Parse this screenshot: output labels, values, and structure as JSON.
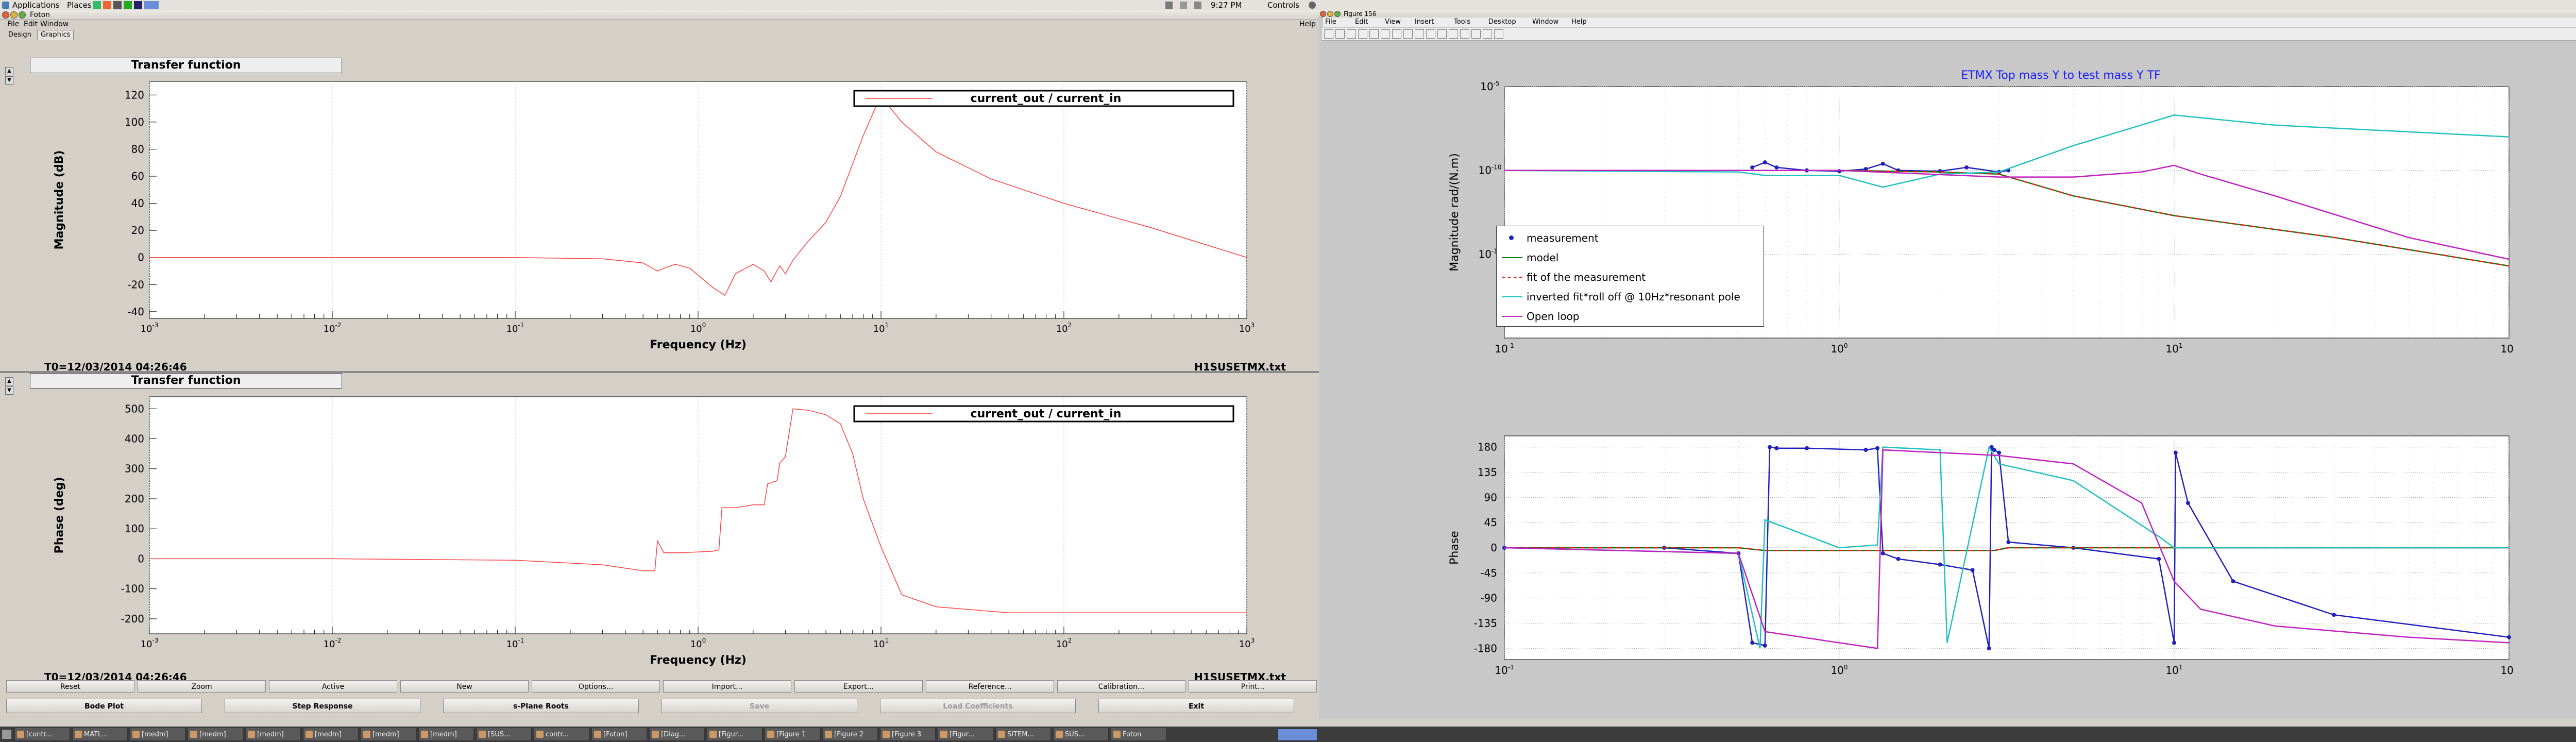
{
  "top_panel": {
    "menus": [
      "Applications",
      "Places"
    ],
    "clock": "9:27 PM",
    "user": "Controls",
    "status_icons": [
      "speaker-icon",
      "mail-icon",
      "network-icon"
    ]
  },
  "foton": {
    "window_title": "Foton",
    "menubar": [
      "File",
      "Edit",
      "Window"
    ],
    "help": "Help",
    "tabs": [
      "Design",
      "Graphics"
    ],
    "plots": [
      {
        "box_title": "Transfer function",
        "legend": "current_out / current_in",
        "ylabel": "Magnitude (dB)",
        "xlabel": "Frequency (Hz)",
        "footer_left": "T0=12/03/2014 04:26:46",
        "footer_right": "H1SUSETMX.txt",
        "yticks": [
          "120",
          "100",
          "80",
          "60",
          "40",
          "20",
          "0",
          "-20",
          "-40"
        ],
        "xticks": [
          "-3",
          "-2",
          "-1",
          "0",
          "1",
          "2",
          "3"
        ]
      },
      {
        "box_title": "Transfer function",
        "legend": "current_out / current_in",
        "ylabel": "Phase (deg)",
        "xlabel": "Frequency (Hz)",
        "footer_left": "T0=12/03/2014 04:26:46",
        "footer_right": "H1SUSETMX.txt",
        "yticks": [
          "500",
          "400",
          "300",
          "200",
          "100",
          "0",
          "-100",
          "-200"
        ],
        "xticks": [
          "-3",
          "-2",
          "-1",
          "0",
          "1",
          "2",
          "3"
        ]
      }
    ],
    "button_row1": [
      "Reset",
      "Zoom",
      "Active",
      "New",
      "Options...",
      "Import...",
      "Export...",
      "Reference...",
      "Calibration...",
      "Print..."
    ],
    "button_row2": [
      "Bode Plot",
      "Step Response",
      "s-Plane Roots",
      "Save",
      "Load Coefficients",
      "Exit"
    ],
    "disabled_buttons": [
      "Save",
      "Load Coefficients"
    ]
  },
  "figure": {
    "window_title": "Figure 156",
    "menubar": [
      "File",
      "Edit",
      "View",
      "Insert",
      "Tools",
      "Desktop",
      "Window",
      "Help"
    ],
    "title": "ETMX Top mass Y to test mass Y TF",
    "mag_ylabel": "Magnitude rad/(N.m)",
    "phase_ylabel": "Phase",
    "legend": [
      "measurement",
      "model",
      "fit of the measurement",
      "inverted fit*roll off @ 10Hz*resonant pole",
      "Open loop"
    ],
    "mag_yticks": [
      "-15",
      "-10",
      "-5"
    ],
    "x_ticks": [
      "-1",
      "0",
      "1",
      "2"
    ],
    "phase_yticks": [
      "180",
      "135",
      "90",
      "45",
      "0",
      "-45",
      "-90",
      "-135",
      "-180"
    ]
  },
  "taskbar": [
    "[contr...",
    "MATL...",
    "[medm]",
    "[medm]",
    "[medm]",
    "[medm]",
    "[medm]",
    "[medm]",
    "[SUS...",
    "contr...",
    "[Foton]",
    "[Diag...",
    "[Figur...",
    "[Figure 1",
    "[Figure 2",
    "[Figure 3",
    "[Figur...",
    "SITEM...",
    "SUS...",
    "Foton"
  ],
  "chart_data": [
    {
      "type": "line",
      "title": "Transfer function",
      "xlabel": "Frequency (Hz)",
      "ylabel": "Magnitude (dB)",
      "xscale": "log",
      "xlim": [
        0.001,
        1000
      ],
      "ylim": [
        -45,
        130
      ],
      "series": [
        {
          "name": "current_out / current_in",
          "color": "#ff4040",
          "x": [
            0.001,
            0.01,
            0.1,
            0.3,
            0.5,
            0.6,
            0.65,
            0.75,
            0.9,
            1.2,
            1.4,
            1.6,
            2.0,
            2.3,
            2.5,
            2.8,
            3.0,
            3.3,
            4,
            5,
            6,
            8,
            10,
            11,
            13,
            20,
            40,
            100,
            300,
            1000
          ],
          "y": [
            0,
            0,
            0,
            -1,
            -4,
            -10,
            -8,
            -5,
            -8,
            -22,
            -28,
            -12,
            -5,
            -10,
            -18,
            -6,
            -12,
            -2,
            12,
            26,
            45,
            90,
            120,
            112,
            100,
            78,
            58,
            40,
            22,
            0
          ]
        }
      ]
    },
    {
      "type": "line",
      "title": "Transfer function",
      "xlabel": "Frequency (Hz)",
      "ylabel": "Phase (deg)",
      "xscale": "log",
      "xlim": [
        0.001,
        1000
      ],
      "ylim": [
        -250,
        540
      ],
      "series": [
        {
          "name": "current_out / current_in",
          "color": "#ff4040",
          "x": [
            0.001,
            0.01,
            0.1,
            0.3,
            0.5,
            0.58,
            0.6,
            0.65,
            0.8,
            1.2,
            1.3,
            1.35,
            1.6,
            2.0,
            2.3,
            2.4,
            2.7,
            2.8,
            3.0,
            3.3,
            4,
            5,
            6,
            7,
            8,
            10,
            13,
            20,
            50,
            100,
            1000
          ],
          "y": [
            0,
            0,
            -5,
            -20,
            -40,
            -40,
            60,
            20,
            20,
            25,
            30,
            170,
            170,
            180,
            180,
            250,
            260,
            320,
            340,
            500,
            495,
            480,
            450,
            350,
            200,
            40,
            -120,
            -160,
            -180,
            -180,
            -180
          ]
        }
      ]
    },
    {
      "type": "line",
      "title": "ETMX Top mass Y to test mass Y TF",
      "ylabel": "Magnitude rad/(N.m)",
      "xscale": "log",
      "yscale": "log",
      "xlim": [
        0.1,
        100
      ],
      "ylim": [
        1e-20,
        1e-05
      ],
      "series": [
        {
          "name": "measurement",
          "color": "#2020c0",
          "x": [
            0.55,
            0.6,
            0.65,
            0.8,
            1.0,
            1.2,
            1.35,
            1.5,
            2.0,
            2.4,
            3.0,
            3.2
          ],
          "y": [
            1.5e-10,
            3e-10,
            1.5e-10,
            1e-10,
            9e-11,
            1.2e-10,
            2.5e-10,
            1e-10,
            9e-11,
            1.5e-10,
            8e-11,
            1e-10
          ]
        },
        {
          "name": "model",
          "color": "#008000",
          "x": [
            0.1,
            0.5,
            1,
            2,
            3,
            5,
            10,
            30,
            100
          ],
          "y": [
            1e-10,
            1e-10,
            1e-10,
            8e-11,
            6e-11,
            3e-12,
            2e-13,
            1e-14,
            2e-16
          ]
        },
        {
          "name": "fit of the measurement",
          "color": "#e02020",
          "x": [
            0.1,
            0.5,
            1,
            2,
            3,
            5,
            10,
            30,
            100
          ],
          "y": [
            1e-10,
            1e-10,
            1e-10,
            8e-11,
            6e-11,
            3e-12,
            2e-13,
            1e-14,
            2e-16
          ]
        },
        {
          "name": "inverted fit*roll off @ 10Hz*resonant pole",
          "color": "#20c0c0",
          "x": [
            0.1,
            0.5,
            0.6,
            1,
            1.35,
            2,
            3,
            5,
            10,
            20,
            50,
            100
          ],
          "y": [
            1e-10,
            8e-11,
            5e-11,
            5e-11,
            1e-11,
            6e-11,
            8e-11,
            3e-09,
            2e-07,
            5e-08,
            2e-08,
            1e-08
          ]
        },
        {
          "name": "Open loop",
          "color": "#c020c0",
          "x": [
            0.1,
            0.5,
            1,
            3,
            5,
            8,
            10,
            12,
            20,
            50,
            100
          ],
          "y": [
            1e-10,
            1e-10,
            1e-10,
            4e-11,
            4e-11,
            8e-11,
            2e-10,
            6e-11,
            3e-12,
            1e-14,
            5e-16
          ]
        }
      ]
    },
    {
      "type": "line",
      "ylabel": "Phase",
      "xscale": "log",
      "xlim": [
        0.1,
        100
      ],
      "ylim": [
        -200,
        200
      ],
      "series": [
        {
          "name": "measurement",
          "color": "#2020c0",
          "x": [
            0.1,
            0.3,
            0.5,
            0.55,
            0.6,
            0.62,
            0.65,
            0.8,
            1.2,
            1.3,
            1.35,
            1.5,
            2.0,
            2.5,
            2.8,
            2.85,
            2.9,
            3.0,
            3.2,
            5,
            9,
            10,
            10.1,
            11,
            15,
            30,
            100
          ],
          "y": [
            0,
            0,
            -10,
            -170,
            -175,
            180,
            178,
            178,
            175,
            178,
            -10,
            -20,
            -30,
            -40,
            -180,
            180,
            175,
            170,
            10,
            0,
            -20,
            -170,
            170,
            80,
            -60,
            -120,
            -160
          ]
        },
        {
          "name": "model",
          "color": "#008000",
          "x": [
            0.1,
            0.5,
            0.6,
            1,
            2,
            2.9,
            3.2,
            5,
            10,
            100
          ],
          "y": [
            0,
            0,
            -5,
            -5,
            -5,
            -5,
            0,
            0,
            0,
            0
          ]
        },
        {
          "name": "fit of the measurement",
          "color": "#e02020",
          "x": [
            0.1,
            0.5,
            0.6,
            1,
            2,
            2.9,
            3.2,
            5,
            10,
            100
          ],
          "y": [
            0,
            0,
            -5,
            -5,
            -5,
            -5,
            0,
            0,
            0,
            0
          ]
        },
        {
          "name": "inverted fit*roll off @ 10Hz*resonant pole",
          "color": "#20c0c0",
          "x": [
            0.1,
            0.5,
            0.58,
            0.6,
            1,
            1.3,
            1.35,
            2,
            2.1,
            2.8,
            3,
            5,
            9,
            10,
            15,
            100
          ],
          "y": [
            0,
            -10,
            -180,
            50,
            0,
            5,
            180,
            175,
            -170,
            180,
            150,
            120,
            20,
            0,
            0,
            0
          ]
        },
        {
          "name": "Open loop",
          "color": "#c020c0",
          "x": [
            0.1,
            0.5,
            0.6,
            1,
            1.3,
            1.35,
            3,
            5,
            8,
            10,
            12,
            20,
            50,
            100
          ],
          "y": [
            0,
            -10,
            -150,
            -170,
            -180,
            175,
            165,
            150,
            80,
            -60,
            -110,
            -140,
            -160,
            -170
          ]
        }
      ]
    }
  ]
}
